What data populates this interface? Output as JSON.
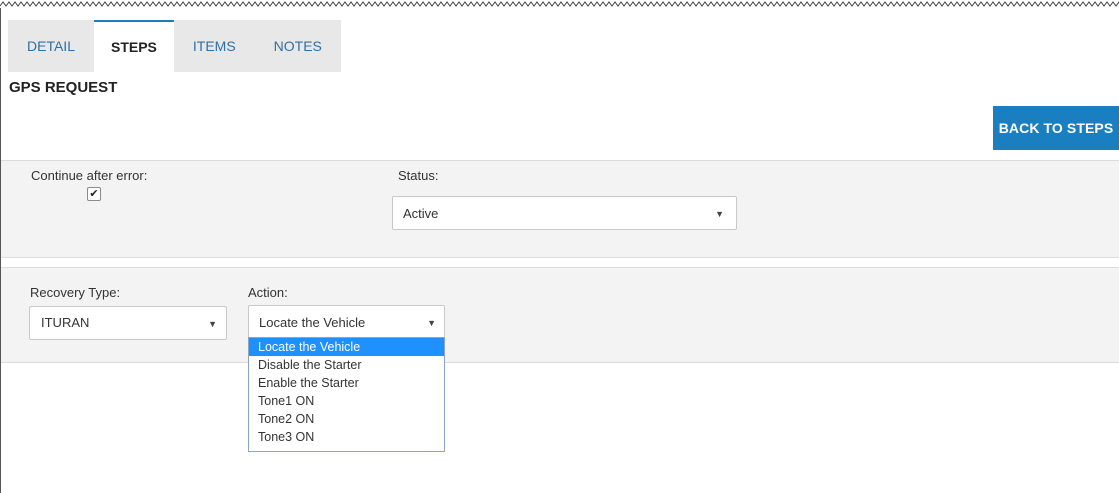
{
  "tabs": [
    {
      "label": "DETAIL",
      "active": false
    },
    {
      "label": "STEPS",
      "active": true
    },
    {
      "label": "ITEMS",
      "active": false
    },
    {
      "label": "NOTES",
      "active": false
    }
  ],
  "page_title": "GPS REQUEST",
  "back_button": "BACK TO STEPS",
  "continue_after_error": {
    "label": "Continue after error:",
    "checked": true
  },
  "status": {
    "label": "Status:",
    "value": "Active"
  },
  "recovery_type": {
    "label": "Recovery Type:",
    "value": "ITURAN"
  },
  "action": {
    "label": "Action:",
    "value": "Locate the Vehicle",
    "options": [
      "Locate the Vehicle",
      "Disable the Starter",
      "Enable the Starter",
      "Tone1 ON",
      "Tone2 ON",
      "Tone3 ON"
    ],
    "highlighted_index": 0
  },
  "colors": {
    "accent": "#1a7fc1",
    "tab_link": "#2f6fa7",
    "highlight": "#1e90ff"
  }
}
